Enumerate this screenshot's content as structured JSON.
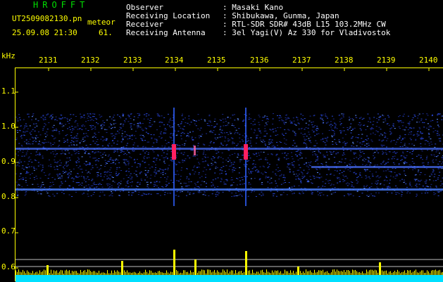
{
  "app_title": "HROFFT",
  "file_name": "UT2509082130.pn",
  "event_label": "meteor",
  "date_time": "25.09.08 21:30",
  "event_count": "61.",
  "header": {
    "rows": [
      {
        "label": "Observer",
        "value": ": Masaki Kano"
      },
      {
        "label": "Receiving Location",
        "value": ": Shibukawa, Gunma, Japan"
      },
      {
        "label": "Receiver",
        "value": ": RTL-SDR SDR# 43dB L15 103.2MHz CW"
      },
      {
        "label": "Receiving Antenna",
        "value": ": 3el Yagi(V) Az 330 for Vladivostok"
      }
    ]
  },
  "axis": {
    "unit": "kHz",
    "x_ticks": [
      "2131",
      "2132",
      "2133",
      "2134",
      "2135",
      "2136",
      "2137",
      "2138",
      "2139",
      "2140"
    ],
    "y_ticks": [
      "1.1",
      "1.0",
      "0.9",
      "0.8",
      "0.7",
      "0.6"
    ]
  },
  "colors": {
    "background": "#000000",
    "text_yellow": "#ffff00",
    "title_green": "#00e000",
    "noise_blue": "#2848d8",
    "echo_red": "#ff2060",
    "baseline_cyan": "#00e0ff"
  }
}
